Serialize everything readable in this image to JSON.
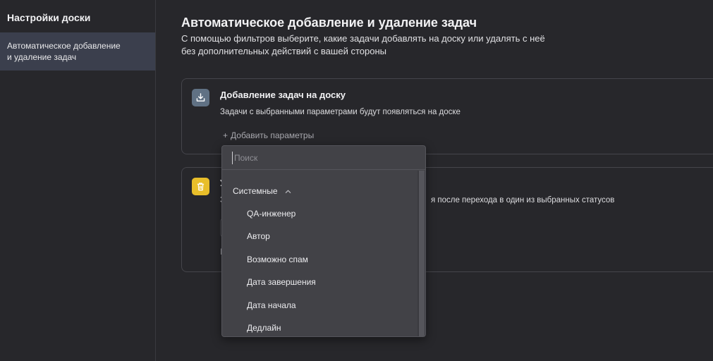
{
  "sidebar": {
    "title": "Настройки доски",
    "items": [
      {
        "label": "Автоматическое добавление\nи удаление задач"
      }
    ]
  },
  "main": {
    "title": "Автоматическое добавление и удаление задач",
    "description": "С помощью фильтров выберите, какие задачи добавлять на доску или удалять с неё без дополнительных действий с вашей стороны",
    "add_card": {
      "icon": "import-tray-icon",
      "title": "Добавление задач на доску",
      "description": "Задачи с выбранными параметрами будут появляться на доске",
      "add_params_label": "Добавить параметры"
    },
    "remove_card": {
      "icon": "trash-icon",
      "title": "У",
      "description_prefix": "З",
      "description_visible": "я после перехода в один из выбранных статусов",
      "stub": "I"
    }
  },
  "dropdown": {
    "search_placeholder": "Поиск",
    "group": "Системные",
    "options": [
      "QA-инженер",
      "Автор",
      "Возможно спам",
      "Дата завершения",
      "Дата начала",
      "Дедлайн"
    ]
  },
  "colors": {
    "background": "#27272b",
    "sidebar_selected": "#3b3f4d",
    "dropdown_bg": "#424247",
    "icon_blue": "#607184",
    "icon_yellow": "#e8be2a"
  }
}
